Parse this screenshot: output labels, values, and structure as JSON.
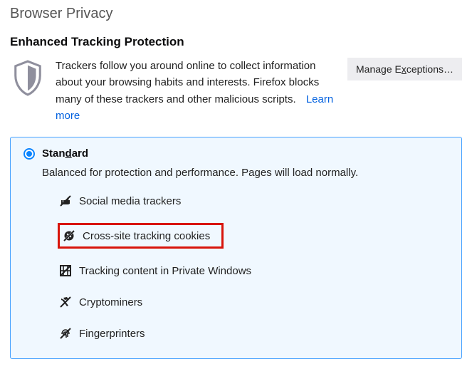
{
  "page_title": "Browser Privacy",
  "etp": {
    "section_title": "Enhanced Tracking Protection",
    "intro": "Trackers follow you around online to collect information about your browsing habits and interests. Firefox blocks many of these trackers and other malicious scripts.",
    "learn_more": "Learn more",
    "manage_exceptions_pre": "Manage E",
    "manage_exceptions_key": "x",
    "manage_exceptions_post": "ceptions…",
    "option": {
      "label_pre": "Stan",
      "label_key": "d",
      "label_post": "ard",
      "description": "Balanced for protection and performance. Pages will load normally.",
      "trackers": [
        {
          "label": "Social media trackers",
          "icon": "thumb-slash-icon"
        },
        {
          "label": "Cross-site tracking cookies",
          "icon": "cookie-slash-icon",
          "highlight": true
        },
        {
          "label": "Tracking content in Private Windows",
          "icon": "fence-slash-icon"
        },
        {
          "label": "Cryptominers",
          "icon": "pick-slash-icon"
        },
        {
          "label": "Fingerprinters",
          "icon": "fingerprint-slash-icon"
        }
      ]
    }
  }
}
